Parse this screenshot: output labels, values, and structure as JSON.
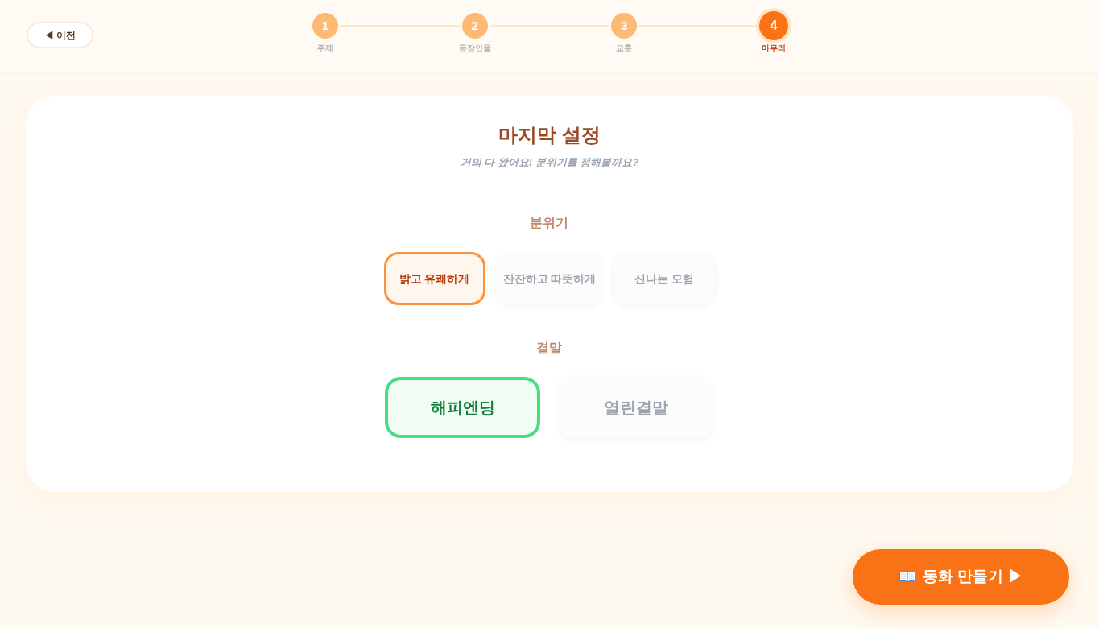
{
  "back_button": {
    "label": "◀ 이전"
  },
  "steps": [
    {
      "number": "1",
      "label": "주제",
      "selected": false
    },
    {
      "number": "2",
      "label": "등장인물",
      "selected": false
    },
    {
      "number": "3",
      "label": "교훈",
      "selected": false
    },
    {
      "number": "4",
      "label": "마무리",
      "selected": true
    }
  ],
  "card": {
    "title": "마지막 설정",
    "subtitle": "거의 다 왔어요! 분위기를 정해볼까요?",
    "sections": [
      {
        "kind": "mood",
        "heading": "분위기",
        "options": [
          {
            "label": "밝고 유쾌하게",
            "selected": true
          },
          {
            "label": "잔잔하고 따뜻하게",
            "selected": false
          },
          {
            "label": "신나는 모험",
            "selected": false
          }
        ]
      },
      {
        "kind": "ending",
        "heading": "결말",
        "options": [
          {
            "label": "해피엔딩",
            "selected": true
          },
          {
            "label": "열린결말",
            "selected": false
          }
        ]
      }
    ]
  },
  "create_button": {
    "label": "동화 만들기 ▶"
  }
}
